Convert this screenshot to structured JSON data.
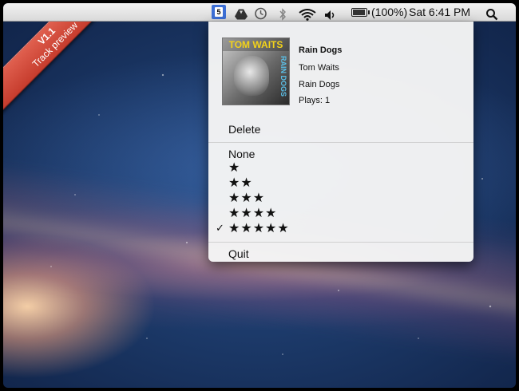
{
  "ribbon": {
    "version": "V1.1",
    "label": "Track preview"
  },
  "menubar": {
    "app_icon_text": "5",
    "battery_text": "(100%)",
    "clock": "Sat 6:41 PM"
  },
  "menu": {
    "track": {
      "album_art_title": "TOM WAITS",
      "album_art_subtitle": "RAIN DOGS",
      "title": "Rain Dogs",
      "artist": "Tom Waits",
      "album": "Rain Dogs",
      "plays": "Plays: 1"
    },
    "delete_label": "Delete",
    "rating_none": "None",
    "ratings": [
      "★",
      "★★",
      "★★★",
      "★★★★",
      "★★★★★"
    ],
    "checked_rating": "✓",
    "quit_label": "Quit"
  }
}
